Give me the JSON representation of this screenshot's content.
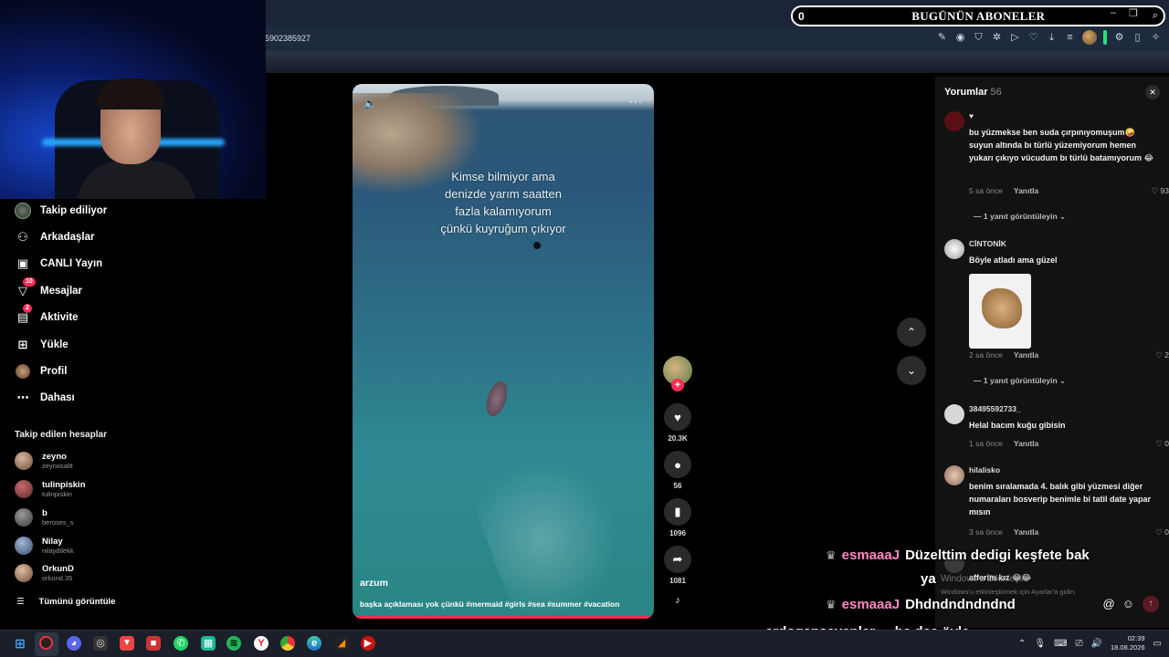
{
  "browser": {
    "url_fragment": "5902385927",
    "window_controls": [
      "–",
      "❐",
      "5"
    ]
  },
  "overlay_subs": {
    "count": "0",
    "title": "BUGÜNÜN ABONELER"
  },
  "sidebar": {
    "nav": [
      {
        "label": "Takip ediliyor",
        "icon": "following-avatar-icon",
        "badge": ""
      },
      {
        "label": "Arkadaşlar",
        "icon": "friends-icon",
        "badge": ""
      },
      {
        "label": "CANLI Yayın",
        "icon": "live-icon",
        "badge": ""
      },
      {
        "label": "Mesajlar",
        "icon": "messages-icon",
        "badge": "10"
      },
      {
        "label": "Aktivite",
        "icon": "activity-icon",
        "badge": "2"
      },
      {
        "label": "Yükle",
        "icon": "upload-icon",
        "badge": ""
      },
      {
        "label": "Profil",
        "icon": "profile-avatar-icon",
        "badge": ""
      },
      {
        "label": "Dahası",
        "icon": "more-icon",
        "badge": ""
      }
    ],
    "following_heading": "Takip edilen hesaplar",
    "following": [
      {
        "name": "zeyno",
        "handle": "zeynosaltt"
      },
      {
        "name": "tulinpiskin",
        "handle": "tulinpiskin"
      },
      {
        "name": "b",
        "handle": "beroses_s"
      },
      {
        "name": "Nilay",
        "handle": "nilaydilekk"
      },
      {
        "name": "OrkunD",
        "handle": "orkund.35"
      }
    ],
    "see_all": "Tümünü görüntüle"
  },
  "video": {
    "caption_lines": [
      "Kimse bilmiyor ama",
      "denizde yarım saatten",
      "fazla kalamıyorum",
      "çünkü kuyruğum çıkıyor"
    ],
    "author": "arzum",
    "description": "başka açıklaması yok çünkü #mermaid #girls #sea #summer #vacation",
    "progress": 1.0
  },
  "actions": {
    "likes": "20.3K",
    "comments": "56",
    "saves": "1096",
    "shares": "1081"
  },
  "comments": {
    "title": "Yorumlar",
    "count": "56",
    "items": [
      {
        "user": "♥",
        "text": "bu yüzmekse ben suda çırpınıyomuşum🤪 suyun altında bı türlü yüzemiyorum hemen yukarı çıkıyo vücudum bı türlü batamıyorum 😂",
        "time": "5 sa önce",
        "reply": "Yanıtla",
        "likes": "93",
        "replies": "1 yanıt görüntüleyin"
      },
      {
        "user": "CİNTONİK",
        "text": "Böyle atladı ama güzel",
        "time": "2 sa önce",
        "reply": "Yanıtla",
        "likes": "2",
        "replies": "1 yanıt görüntüleyin"
      },
      {
        "user": "38495592733_",
        "text": "Helal bacım kuğu gibisin",
        "time": "1 sa önce",
        "reply": "Yanıtla",
        "likes": "0"
      },
      {
        "user": "hilalisko",
        "text": "benim sıralamada 4. balık gibi yüzmesi diğer numaraları bosverip benimle bi tatil date yapar mısın",
        "time": "3 sa önce",
        "reply": "Yanıtla",
        "likes": "0"
      },
      {
        "user": "",
        "text": "afferim kız 😂😂",
        "time": "",
        "reply": "",
        "likes": ""
      }
    ],
    "input_placeholder": ""
  },
  "windows_notice": {
    "line1": "Windows'u Etkinleştir",
    "line2": "Windows'u etkinleştirmek için Ayarlar'a gidin."
  },
  "chat": [
    {
      "user": "esmaaaJ",
      "text": "Düzelttim dedigi keşfete bak",
      "text2": "ya"
    },
    {
      "user": "esmaaaJ",
      "text": "Dhdndndndndnd",
      "text2": ""
    },
    {
      "user": "erdogansevenler...",
      "text": "he dae öyle",
      "text2": ""
    }
  ],
  "taskbar": {
    "time": "02:39",
    "date": "18.08.2026"
  },
  "colors": {
    "accent": "#fe2c55",
    "chat_user": "#ff87c2",
    "taskbar": "#1b1f2a"
  }
}
